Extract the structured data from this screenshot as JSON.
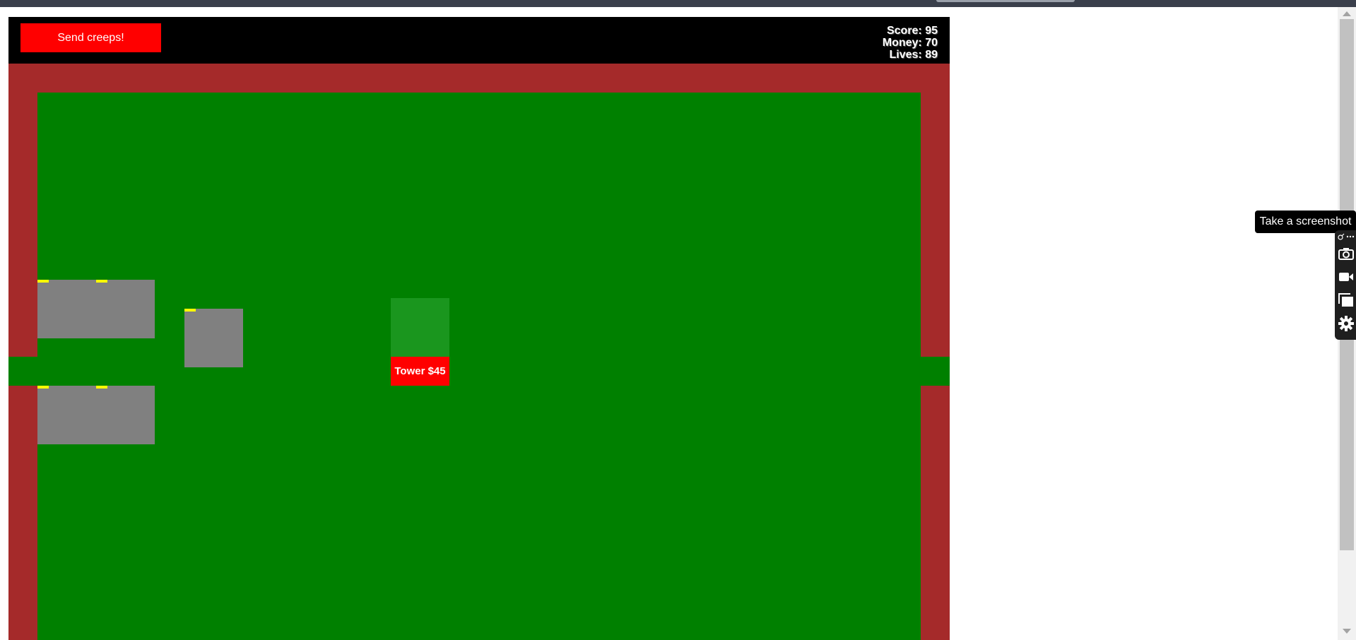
{
  "hud": {
    "send_button": "Send creeps!",
    "score": "Score: 95",
    "money": "Money: 70",
    "lives": "Lives: 89"
  },
  "store": {
    "tower_button": "Tower $45"
  },
  "towers": [
    {
      "name": "tower-top-left",
      "health": 1.0
    },
    {
      "name": "tower-middle",
      "health": 1.0
    },
    {
      "name": "tower-bottom-left",
      "health": 1.0
    }
  ],
  "extension": {
    "tooltip": "Take a screenshot",
    "icons": [
      "pin-icon",
      "more-icon",
      "camera-icon",
      "video-camera-icon",
      "window-capture-icon",
      "gear-icon"
    ]
  },
  "colors": {
    "hud_background": "#000000",
    "button_red": "#ff0000",
    "border_brown": "#a52a2a",
    "field_green": "#008000",
    "placement_green": "#1a961e",
    "tower_gray": "#808080",
    "health_yellow": "#ffff00"
  }
}
